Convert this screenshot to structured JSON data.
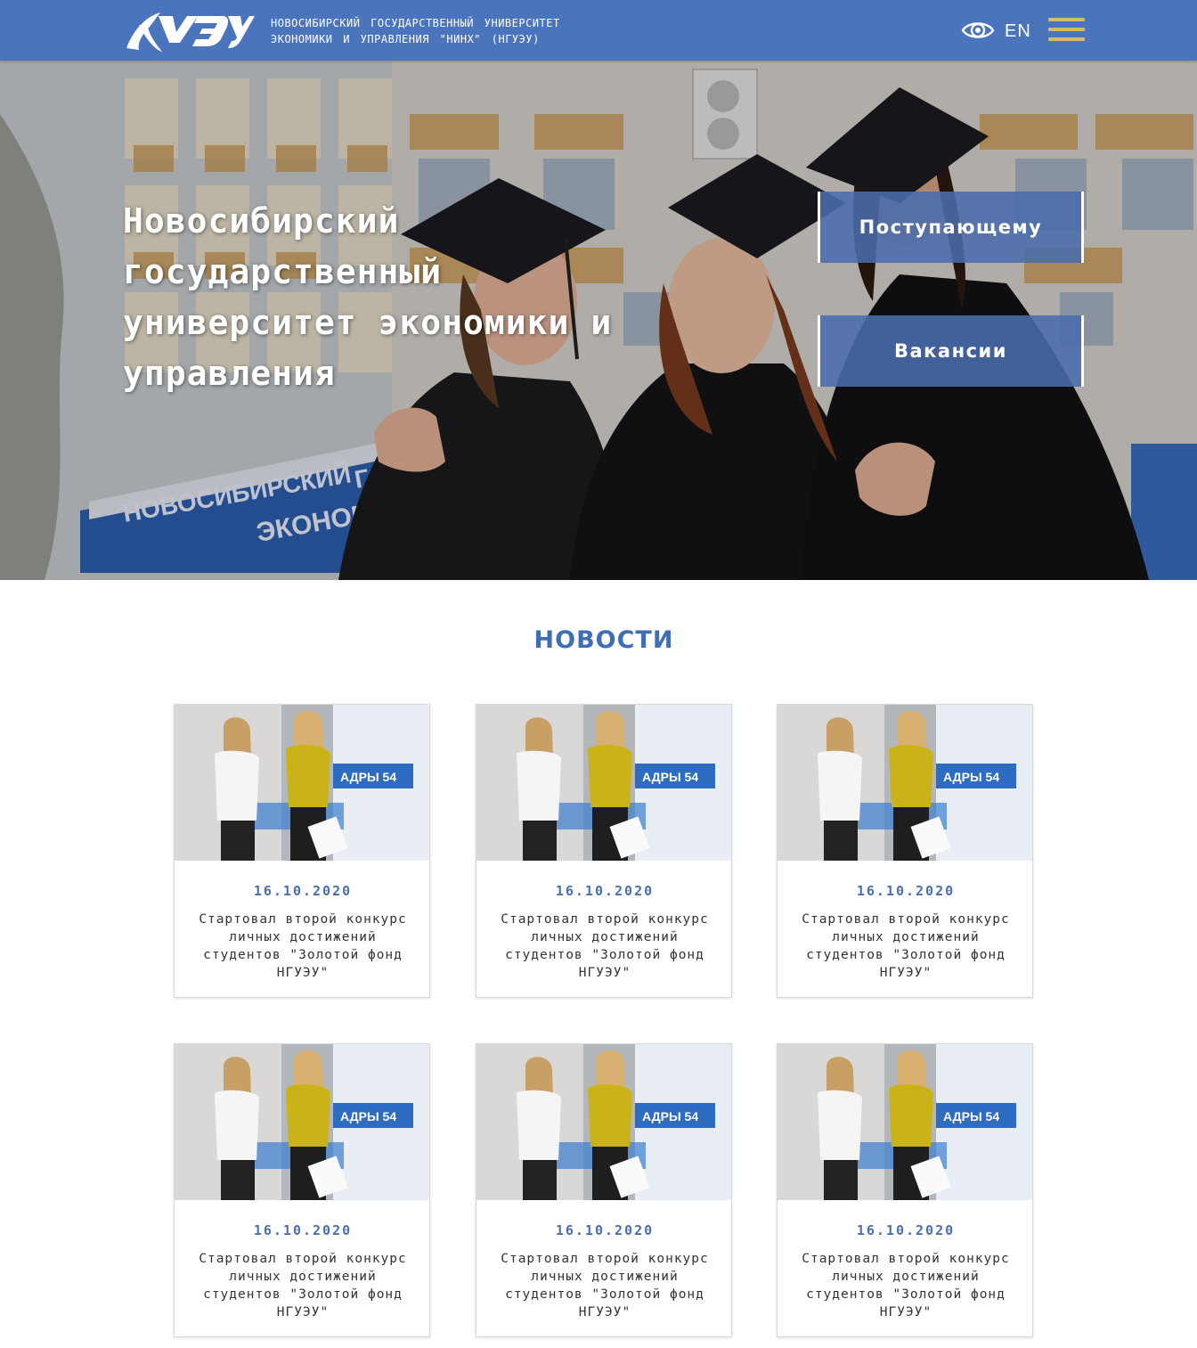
{
  "header": {
    "org_line1": "НОВОСИБИРСКИЙ ГОСУДАРСТВЕННЫЙ УНИВЕРСИТЕТ",
    "org_line2": "ЭКОНОМИКИ И УПРАВЛЕНИЯ \"НИНХ\" (НГУЭУ)",
    "lang": "EN",
    "accessibility_icon": "eye-icon",
    "menu_icon": "hamburger-menu-icon"
  },
  "hero": {
    "title": "Новосибирский государственный университет экономики и управления",
    "sign_line1": "НОВОСИБИРСКИЙ",
    "sign_line2": "ЭКОНОМИ",
    "sign_line3": "ГО",
    "buttons": [
      "Поступающему",
      "Вакансии"
    ]
  },
  "news": {
    "title": "НОВОСТИ",
    "image_banner": "АДРЫ 54",
    "items": [
      {
        "date": "16.10.2020",
        "text": "Стартовал второй конкурс личных достижений студентов \"Золотой фонд НГУЭУ\""
      },
      {
        "date": "16.10.2020",
        "text": "Стартовал второй конкурс личных достижений студентов \"Золотой фонд НГУЭУ\""
      },
      {
        "date": "16.10.2020",
        "text": "Стартовал второй конкурс личных достижений студентов \"Золотой фонд НГУЭУ\""
      },
      {
        "date": "16.10.2020",
        "text": "Стартовал второй конкурс личных достижений студентов \"Золотой фонд НГУЭУ\""
      },
      {
        "date": "16.10.2020",
        "text": "Стартовал второй конкурс личных достижений студентов \"Золотой фонд НГУЭУ\""
      },
      {
        "date": "16.10.2020",
        "text": "Стартовал второй конкурс личных достижений студентов \"Золотой фонд НГУЭУ\""
      }
    ]
  },
  "colors": {
    "header_bg": "#4a75bd",
    "accent_gold": "#d4b96e",
    "news_title": "#3f6db6",
    "date": "#4a6fae"
  }
}
